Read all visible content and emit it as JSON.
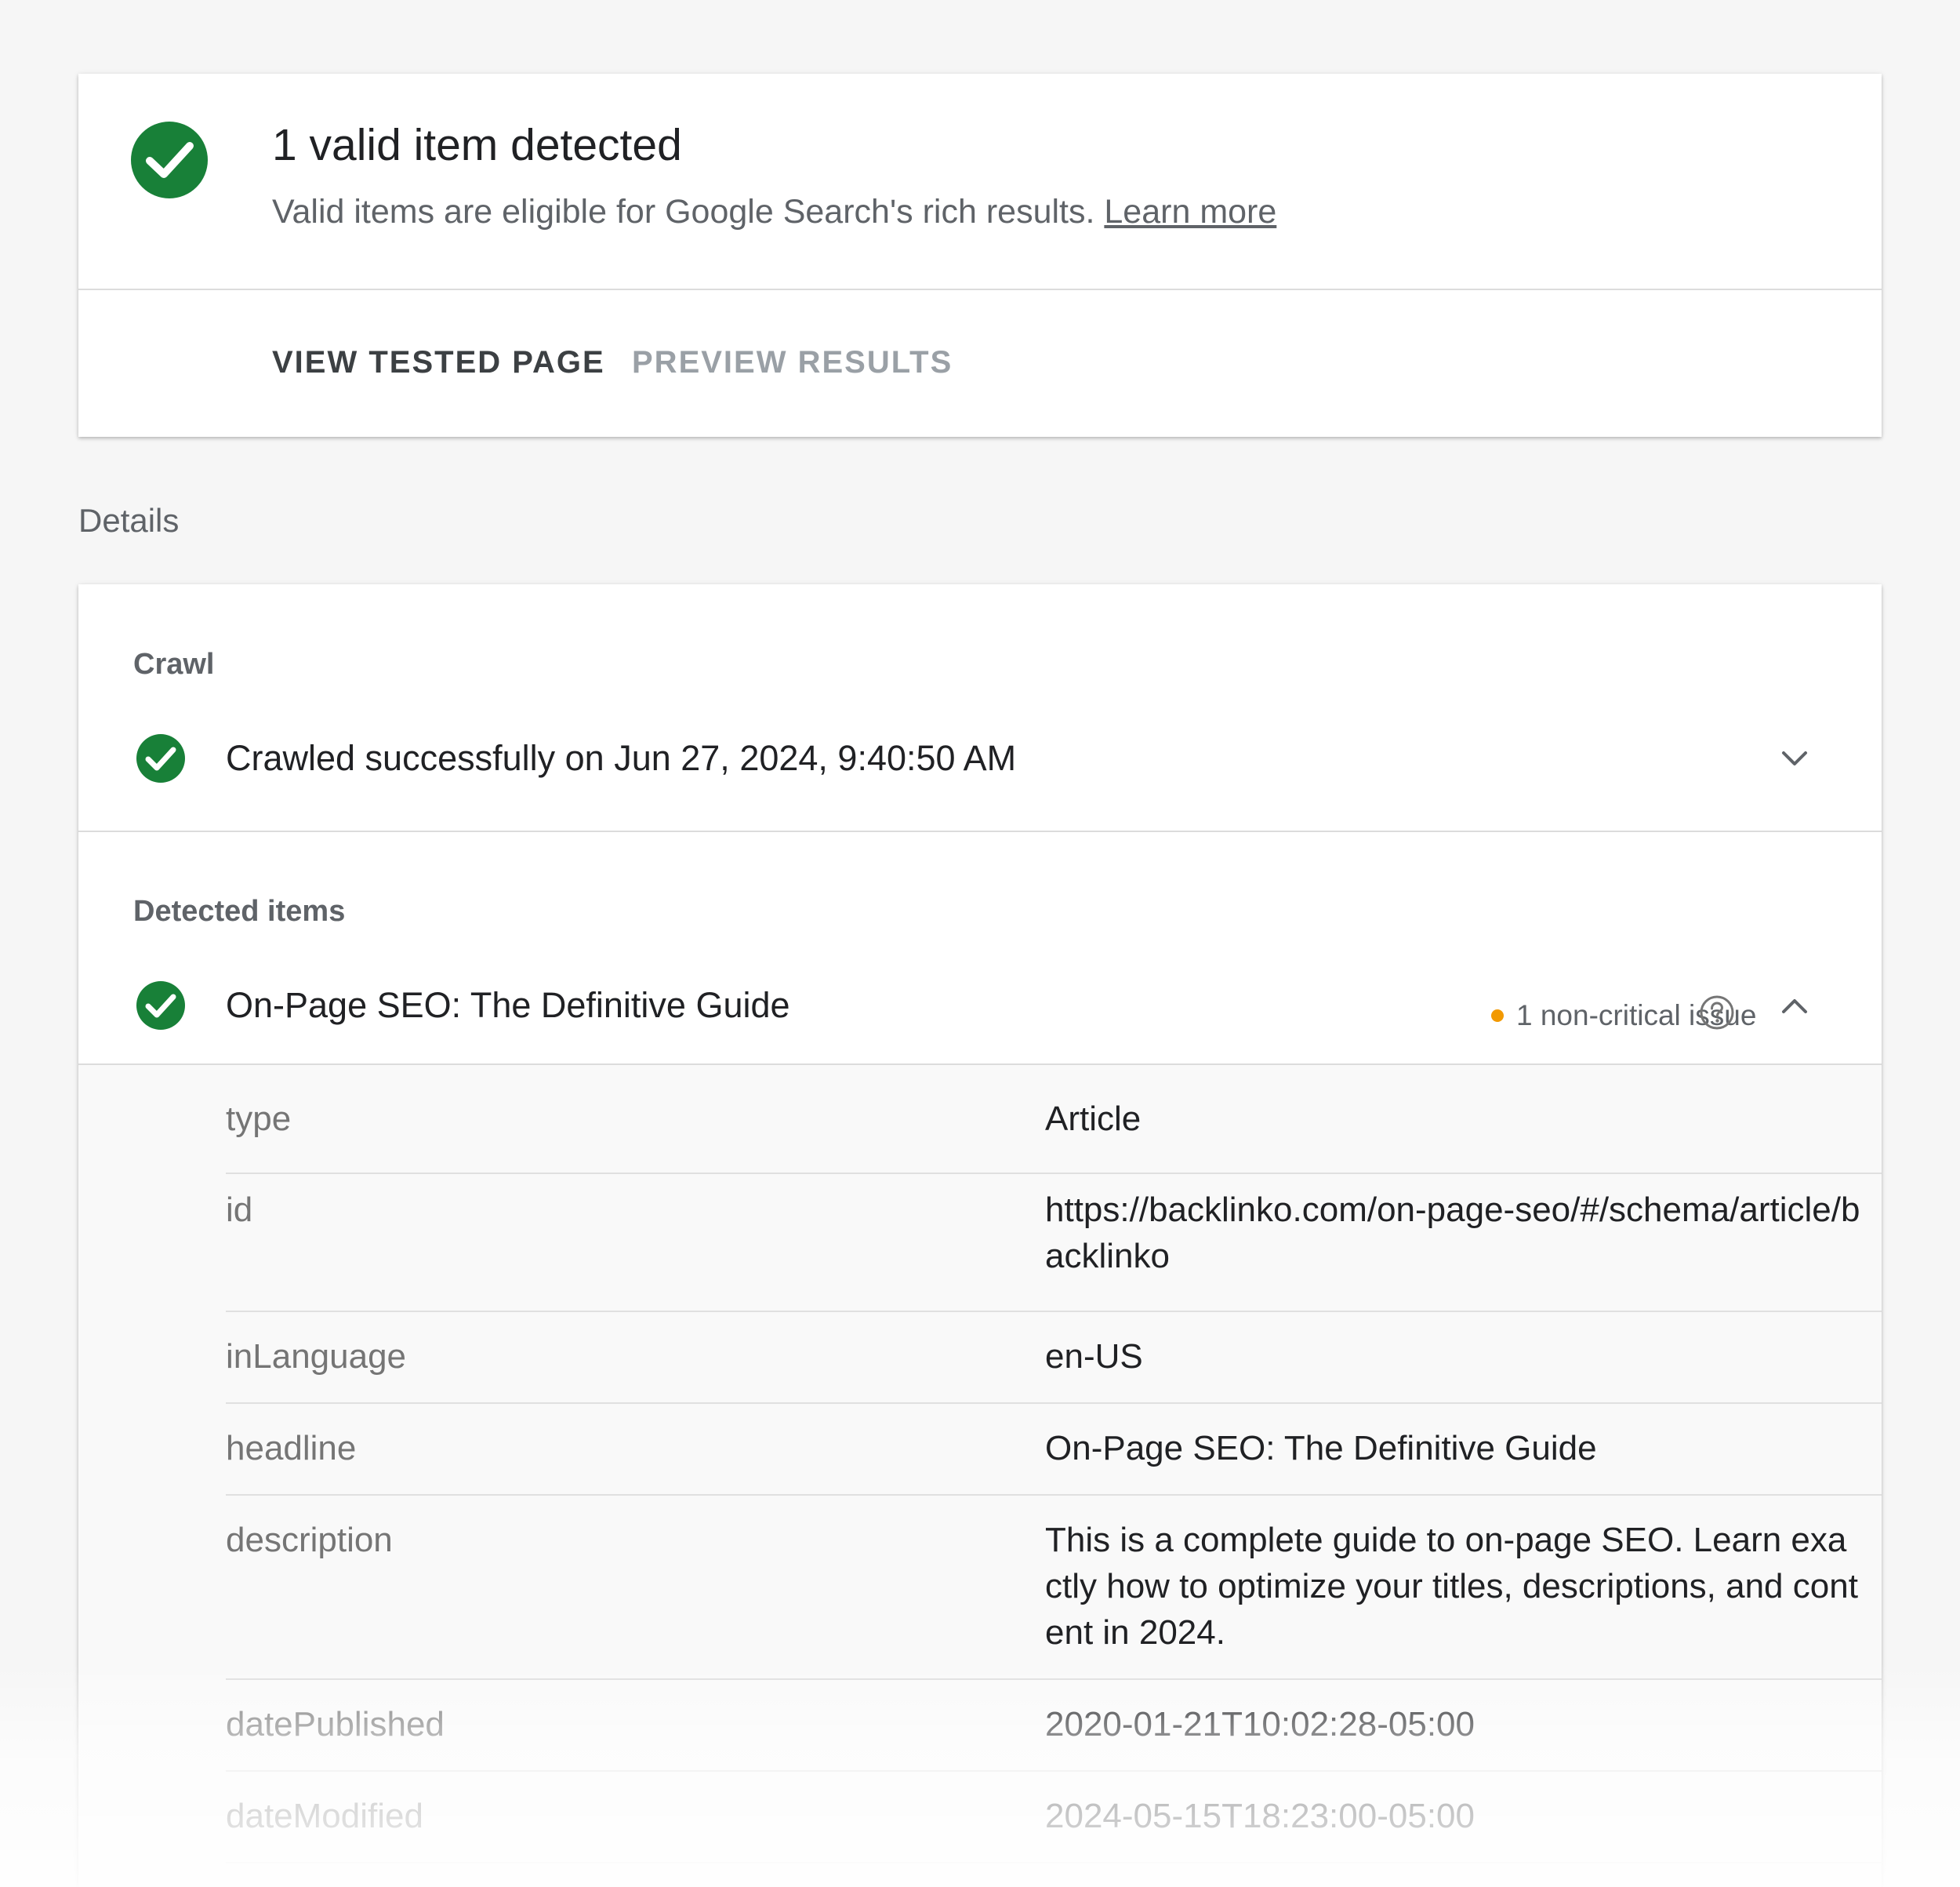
{
  "summary": {
    "title": "1 valid item detected",
    "subtitle": "Valid items are eligible for Google Search's rich results.",
    "learn_more": "Learn more",
    "actions": {
      "view_tested_page": "VIEW TESTED PAGE",
      "preview_results": "PREVIEW RESULTS"
    }
  },
  "details": {
    "label": "Details",
    "crawl": {
      "section_label": "Crawl",
      "status_text": "Crawled successfully on Jun 27, 2024, 9:40:50 AM"
    },
    "detected_items": {
      "section_label": "Detected items",
      "item_title": "On-Page SEO: The Definitive Guide",
      "issue_text": "1 non-critical issue",
      "properties": [
        {
          "key": "type",
          "value": "Article"
        },
        {
          "key": "id",
          "value": "https://backlinko.com/on-page-seo/#/schema/article/backlinko"
        },
        {
          "key": "inLanguage",
          "value": "en-US"
        },
        {
          "key": "headline",
          "value": "On-Page SEO: The Definitive Guide"
        },
        {
          "key": "description",
          "value": "This is a complete guide to on-page SEO. Learn exactly how to optimize your titles, descriptions, and content in 2024."
        },
        {
          "key": "datePublished",
          "value": "2020-01-21T10:02:28-05:00"
        },
        {
          "key": "dateModified",
          "value": "2024-05-15T18:23:00-05:00"
        }
      ]
    }
  },
  "colors": {
    "success_green": "#188038",
    "issue_orange": "#f29900",
    "text_primary": "#202124",
    "text_secondary": "#5f6368"
  }
}
